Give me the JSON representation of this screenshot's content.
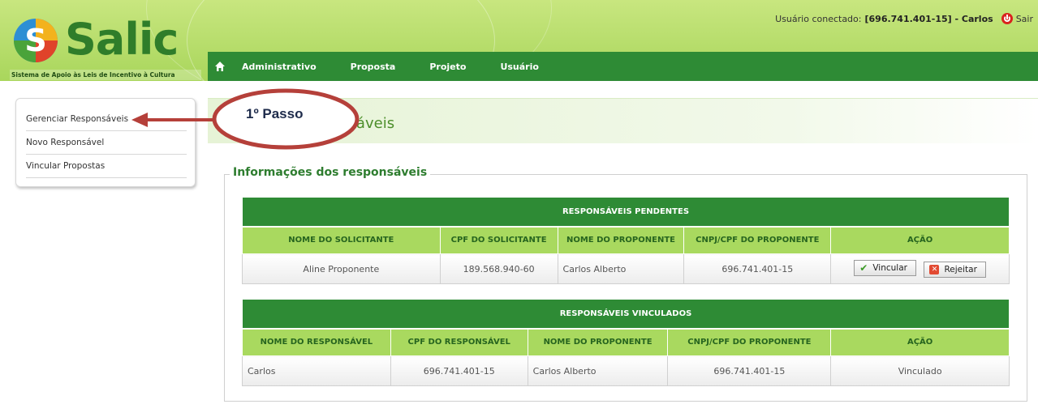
{
  "app": {
    "logo_word": "Salic",
    "tagline": "Sistema de Apoio às Leis de Incentivo à Cultura"
  },
  "user_bar": {
    "label": "Usuário conectado:",
    "user": "[696.741.401-15] - Carlos",
    "logout": "Sair"
  },
  "nav": {
    "items": [
      "Administrativo",
      "Proposta",
      "Projeto",
      "Usuário"
    ]
  },
  "sidebar": {
    "items": [
      "Gerenciar Responsáveis",
      "Novo Responsável",
      "Vincular Propostas"
    ]
  },
  "page": {
    "title": "Gerenciar Responsáveis"
  },
  "info": {
    "legend": "Informações dos responsáveis"
  },
  "pending": {
    "caption": "RESPONSÁVEIS PENDENTES",
    "headers": [
      "NOME DO SOLICITANTE",
      "CPF DO SOLICITANTE",
      "NOME DO PROPONENTE",
      "CNPJ/CPF DO PROPONENTE",
      "AÇÃO"
    ],
    "row": {
      "name": "Aline Proponente",
      "cpf": "189.568.940-60",
      "proponent": "Carlos Alberto",
      "cnpj": "696.741.401-15",
      "approve": "Vincular",
      "reject": "Rejeitar"
    }
  },
  "linked": {
    "caption": "RESPONSÁVEIS VINCULADOS",
    "headers": [
      "NOME DO RESPONSÁVEL",
      "CPF DO RESPONSÁVEL",
      "NOME DO PROPONENTE",
      "CNPJ/CPF DO PROPONENTE",
      "AÇÃO"
    ],
    "row": {
      "name": "Carlos",
      "cpf": "696.741.401-15",
      "proponent": "Carlos Alberto",
      "cnpj": "696.741.401-15",
      "status": "Vinculado"
    }
  },
  "annotation": {
    "label": "1º Passo"
  },
  "colors": {
    "header_bg": "#b8de6e",
    "nav_bg": "#2e8b35",
    "table_caption": "#2e8b35",
    "table_header": "#a9d95f",
    "annotation": "#b5403a"
  }
}
